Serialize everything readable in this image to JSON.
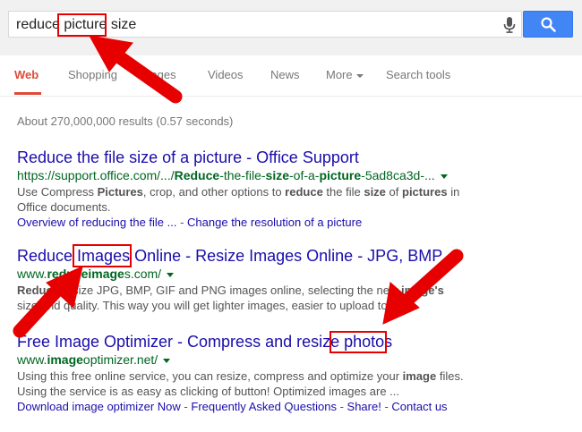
{
  "search": {
    "query_parts": [
      "reduce ",
      "picture",
      " size"
    ],
    "button_color": "#4285f4"
  },
  "tabs": [
    {
      "label": "Web",
      "active": true
    },
    {
      "label": "Shopping"
    },
    {
      "label": "Images"
    },
    {
      "label": "Videos"
    },
    {
      "label": "News"
    },
    {
      "label": "More"
    },
    {
      "label": "Search tools"
    }
  ],
  "result_stats": "About 270,000,000 results (0.57 seconds)",
  "results": [
    {
      "title": "Reduce the file size of a picture - Office Support",
      "url_parts": [
        "https://support.office.com/.../",
        "Reduce",
        "-the-file-",
        "size",
        "-of-a-",
        "picture",
        "-5ad8ca3d-..."
      ],
      "snippet_line1_parts": [
        "Use Compress ",
        "Pictures",
        ", crop, and other options to ",
        "reduce",
        " the file ",
        "size",
        " of ",
        "pictures",
        " in"
      ],
      "snippet_line2": "Office documents.",
      "sitelinks": [
        "Overview of reducing the file ...",
        "Change the resolution of a picture"
      ]
    },
    {
      "title_parts": [
        "Reduce ",
        "Images",
        " Online - Resize Images Online - JPG, BMP"
      ],
      "url_parts": [
        "www.",
        "reduceimage",
        "s.com/"
      ],
      "snippet_line1_parts": [
        "Reduce",
        " resize JPG, BMP, GIF and PNG images online, selecting the new ",
        "image's"
      ],
      "snippet_line2": "size and quality. This way you will get lighter images, easier to upload to ..."
    },
    {
      "title_parts": [
        "Free Image Optimizer - Compress and resize ",
        "photos"
      ],
      "url_parts": [
        "www.",
        "image",
        "optimizer.net/"
      ],
      "snippet_line1_parts": [
        "Using this free online service, you can resize, compress and optimize your ",
        "image",
        " files."
      ],
      "snippet_line2": "Using the service is as easy as clicking of button! Optimized images are ...",
      "sitelinks": [
        "Download image optimizer Now",
        "Frequently Asked Questions",
        "Share!",
        "Contact us"
      ]
    }
  ],
  "annotation_color": "#e60000",
  "link_color": "#1a0dab",
  "url_color": "#006621",
  "active_tab_color": "#dd4b39"
}
